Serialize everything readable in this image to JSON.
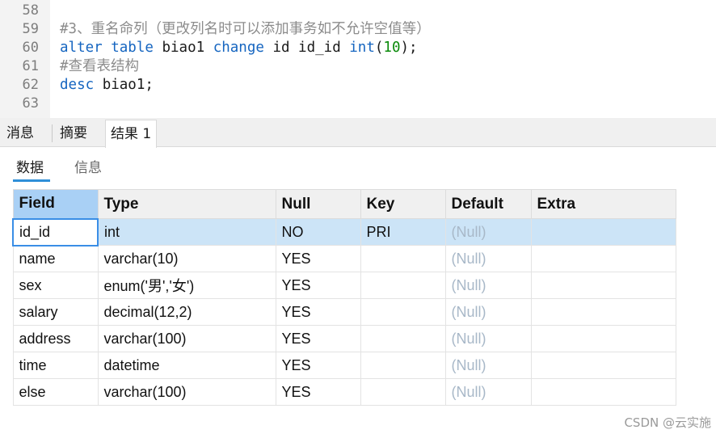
{
  "editor": {
    "lines": [
      {
        "num": "58",
        "tokens": []
      },
      {
        "num": "59",
        "tokens": [
          {
            "t": "#3、重名命列（更改列名时可以添加事务如不允许空值等）",
            "c": "cm"
          }
        ]
      },
      {
        "num": "60",
        "tokens": [
          {
            "t": "alter",
            "c": "kw"
          },
          {
            "t": " ",
            "c": ""
          },
          {
            "t": "table",
            "c": "kw"
          },
          {
            "t": " biao1 ",
            "c": ""
          },
          {
            "t": "change",
            "c": "kw"
          },
          {
            "t": " id id_id ",
            "c": ""
          },
          {
            "t": "int",
            "c": "kw"
          },
          {
            "t": "(",
            "c": ""
          },
          {
            "t": "10",
            "c": "num"
          },
          {
            "t": ");",
            "c": ""
          }
        ]
      },
      {
        "num": "61",
        "tokens": [
          {
            "t": "#查看表结构",
            "c": "cm"
          }
        ]
      },
      {
        "num": "62",
        "tokens": [
          {
            "t": "desc",
            "c": "kw"
          },
          {
            "t": " biao1;",
            "c": ""
          }
        ]
      },
      {
        "num": "63",
        "tokens": []
      }
    ]
  },
  "tabs": {
    "messages": "消息",
    "summary": "摘要",
    "result1": "结果 1"
  },
  "subtabs": {
    "data": "数据",
    "info": "信息"
  },
  "grid": {
    "columns": [
      "Field",
      "Type",
      "Null",
      "Key",
      "Default",
      "Extra"
    ],
    "rows": [
      [
        "id_id",
        "int",
        "NO",
        "PRI",
        "(Null)",
        ""
      ],
      [
        "name",
        "varchar(10)",
        "YES",
        "",
        "(Null)",
        ""
      ],
      [
        "sex",
        "enum('男','女')",
        "YES",
        "",
        "(Null)",
        ""
      ],
      [
        "salary",
        "decimal(12,2)",
        "YES",
        "",
        "(Null)",
        ""
      ],
      [
        "address",
        "varchar(100)",
        "YES",
        "",
        "(Null)",
        ""
      ],
      [
        "time",
        "datetime",
        "YES",
        "",
        "(Null)",
        ""
      ],
      [
        "else",
        "varchar(100)",
        "YES",
        "",
        "(Null)",
        ""
      ]
    ]
  },
  "watermark": "CSDN @云实施",
  "colors": {
    "keyword": "#1565c0",
    "number": "#0a8a0a",
    "comment": "#8c8c8c",
    "selection": "#cce4f7",
    "header_selected": "#a9d0f5",
    "null_text": "#a8b8c8",
    "tab_underline": "#2f8fd8"
  }
}
